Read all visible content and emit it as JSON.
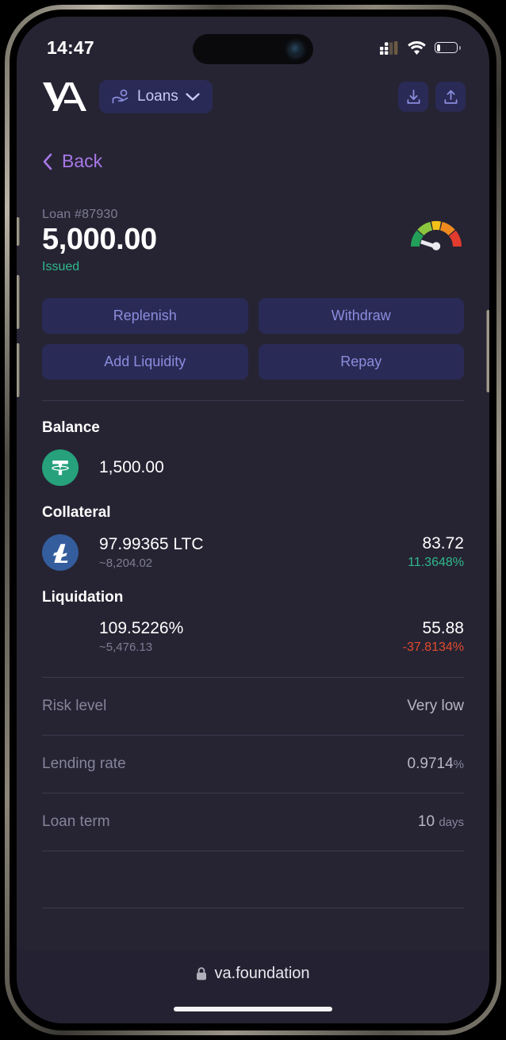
{
  "status_bar": {
    "time": "14:47",
    "signal_icon": "cellular-signal-icon",
    "wifi_icon": "wifi-icon",
    "battery_icon": "battery-low-icon",
    "battery_level_pct": 18
  },
  "header": {
    "logo": "va-logo",
    "nav_pill": {
      "icon": "hand-coin-icon",
      "label": "Loans",
      "chevron": "chevron-down-icon"
    },
    "actions": [
      {
        "name": "download-button",
        "icon": "download-icon"
      },
      {
        "name": "upload-button",
        "icon": "upload-icon"
      }
    ]
  },
  "back": {
    "icon": "chevron-left-icon",
    "label": "Back"
  },
  "loan": {
    "id_label": "Loan #87930",
    "amount": "5,000.00",
    "status": "Issued",
    "gauge": {
      "name": "risk-gauge",
      "segments": [
        "#22a05a",
        "#8cc63f",
        "#f2c018",
        "#f08a1e",
        "#e33b2e"
      ],
      "needle_fraction": 0.12
    }
  },
  "actions": [
    {
      "name": "replenish-button",
      "label": "Replenish"
    },
    {
      "name": "withdraw-button",
      "label": "Withdraw"
    },
    {
      "name": "add-liquidity-button",
      "label": "Add Liquidity"
    },
    {
      "name": "repay-button",
      "label": "Repay"
    }
  ],
  "balance": {
    "title": "Balance",
    "asset": {
      "coin_icon": "tether-usdt-icon",
      "amount": "1,500.00"
    }
  },
  "collateral": {
    "title": "Collateral",
    "asset": {
      "coin_icon": "litecoin-icon",
      "amount": "97.99365 LTC",
      "approx_value": "~8,204.02",
      "price": "83.72",
      "change": "11.3648%",
      "change_sign": "positive"
    }
  },
  "liquidation": {
    "title": "Liquidation",
    "ratio": "109.5226%",
    "approx_value": "~5,476.13",
    "price": "55.88",
    "change": "-37.8134%",
    "change_sign": "negative"
  },
  "info_rows": [
    {
      "name": "risk-level",
      "label": "Risk level",
      "value": "Very low",
      "unit": ""
    },
    {
      "name": "lending-rate",
      "label": "Lending rate",
      "value": "0.9714",
      "unit": "%"
    },
    {
      "name": "loan-term",
      "label": "Loan term",
      "value": "10",
      "unit": "days"
    }
  ],
  "browser_bar": {
    "lock_icon": "lock-icon",
    "url": "va.foundation"
  },
  "colors": {
    "screen_bg": "#262433",
    "accent_purple": "#a879e8",
    "button_bg": "#2a2a56",
    "button_text": "#8a8ddd",
    "positive": "#2fb98c",
    "negative": "#e24a2c",
    "usdt_green": "#26a17b",
    "ltc_blue": "#345d9d"
  }
}
